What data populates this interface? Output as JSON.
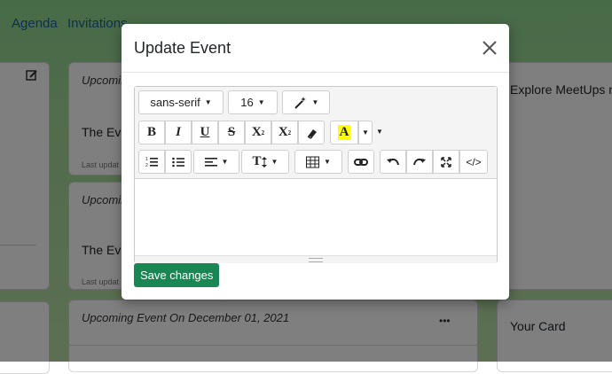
{
  "nav": {
    "agenda": "Agenda",
    "invitations": "Invitations"
  },
  "background": {
    "card_a": {
      "header": "Upcoming",
      "title": "The Eve",
      "updated": "Last updat"
    },
    "card_b": {
      "header": "Upcomin",
      "title": "The Eve",
      "updated": "Last updat"
    },
    "card_c": {
      "header": "Upcoming Event On December 01, 2021",
      "more": "•••"
    },
    "right_top": "Explore MeetUps n",
    "right_bottom": "Your Card"
  },
  "modal": {
    "title": "Update Event",
    "close_glyph": "×",
    "save_label": "Save changes"
  },
  "toolbar": {
    "font_family": "sans-serif",
    "font_size": "16",
    "bold": "B",
    "italic": "I",
    "underline": "U",
    "strike": "S",
    "superscript": "X",
    "subscript": "X",
    "highlight": "A",
    "line_height": "T",
    "code": "</>"
  },
  "colors": {
    "accent": "#198754",
    "highlight_bg": "#ffff00",
    "link": "#1f5fa6"
  }
}
